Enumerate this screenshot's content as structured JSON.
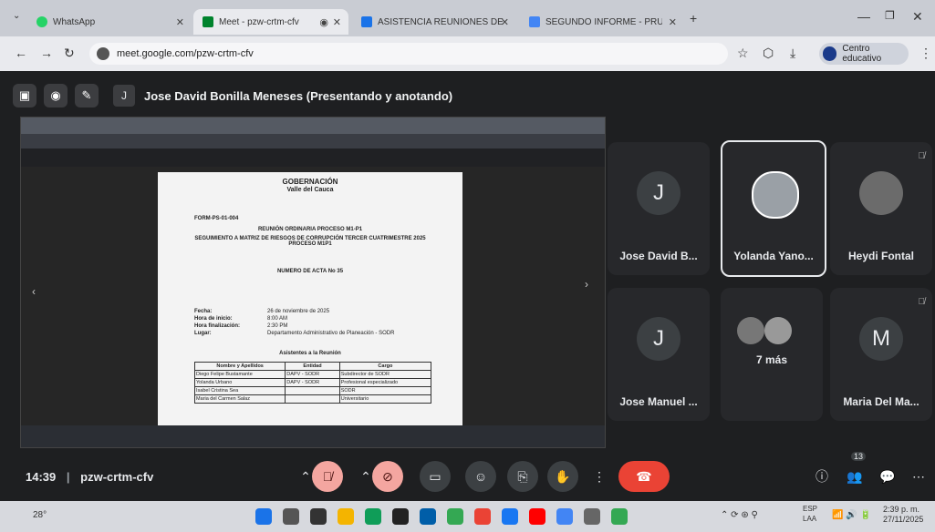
{
  "browser": {
    "tabs": [
      {
        "label": "WhatsApp",
        "active": false
      },
      {
        "label": "Meet - pzw-crtm-cfv",
        "active": true
      },
      {
        "label": "ASISTENCIA REUNIONES DE TI",
        "active": false
      },
      {
        "label": "SEGUNDO INFORME - PRUEBA",
        "active": false
      }
    ],
    "url": "meet.google.com/pzw-crtm-cfv",
    "profile": "Centro educativo"
  },
  "meet": {
    "presenter": {
      "initial": "J",
      "label": "Jose David Bonilla Meneses (Presentando y anotando)"
    },
    "document": {
      "header1": "GOBERNACIÓN",
      "header2": "Valle del Cauca",
      "code": "FORM-PS-01-004",
      "title1": "REUNIÓN ORDINARIA PROCESO M1-P1",
      "title2": "SEGUIMIENTO A MATRIZ DE RIESGOS DE CORRUPCIÓN TERCER CUATRIMESTRE 2025 PROCESO M1P1",
      "acta": "NUMERO DE ACTA No 35",
      "fecha_label": "Fecha:",
      "fecha_value": "26 de noviembre de 2025",
      "inicio_label": "Hora de inicio:",
      "inicio_value": "8:00 AM",
      "fin_label": "Hora finalización:",
      "fin_value": "2:30 PM",
      "lugar_label": "Lugar:",
      "lugar_value": "Departamento Administrativo de Planeación - SODR",
      "asistentes": "Asistentes a la Reunión",
      "table_headers": [
        "Nombre y Apellidos",
        "Entidad",
        "Cargo"
      ],
      "table_rows": [
        [
          "Diego Felipe Bustamante",
          "DAPV - SODR",
          "Subdirector de SODR"
        ],
        [
          "Yolanda Urbano",
          "DAPV - SODR",
          "Profesional especializado"
        ],
        [
          "Isabel Cristina Sea",
          "",
          "SODR"
        ],
        [
          "Maria del Carmen Salaz",
          "",
          "Universitario"
        ]
      ]
    },
    "participants": [
      {
        "initial": "J",
        "name": "Jose David B...",
        "highlight": false
      },
      {
        "initial": "",
        "name": "Yolanda Yano...",
        "highlight": true
      },
      {
        "initial": "",
        "name": "Heydi Fontal",
        "highlight": false
      },
      {
        "initial": "J",
        "name": "Jose Manuel ...",
        "highlight": false
      },
      {
        "initial": "",
        "name": "7 más",
        "highlight": false
      },
      {
        "initial": "M",
        "name": "Maria Del Ma...",
        "highlight": false
      }
    ],
    "bottom": {
      "time": "14:39",
      "separator": "|",
      "code": "pzw-crtm-cfv",
      "people_count": "13"
    }
  },
  "taskbar": {
    "temp": "28°",
    "lang1": "ESP",
    "lang2": "LAA",
    "time": "2:39 p. m.",
    "date": "27/11/2025"
  },
  "colors": {
    "end_call": "#ea4335",
    "accent": "#8ab4f8"
  }
}
